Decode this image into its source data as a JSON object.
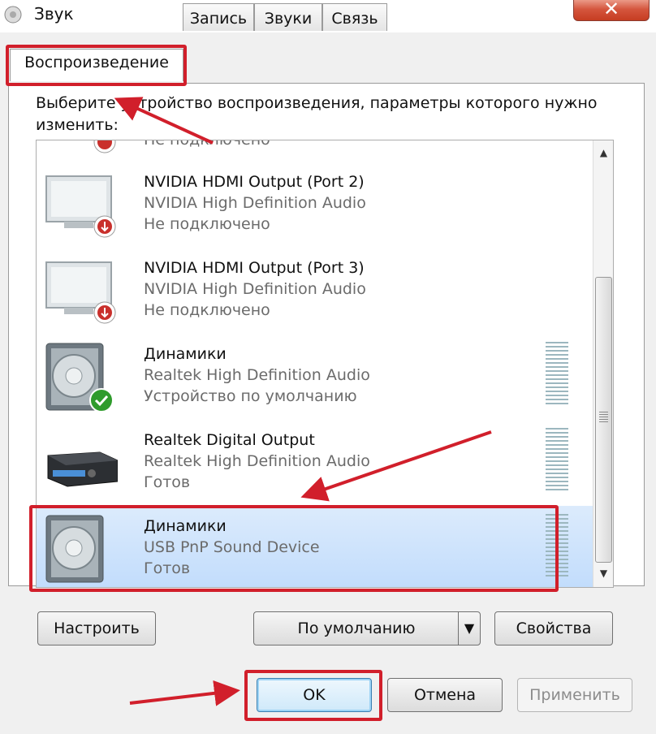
{
  "window": {
    "title": "Звук"
  },
  "tabs": [
    {
      "label": "Воспроизведение",
      "active": true
    },
    {
      "label": "Запись",
      "active": false
    },
    {
      "label": "Звуки",
      "active": false
    },
    {
      "label": "Связь",
      "active": false
    }
  ],
  "instruction": "Выберите устройство воспроизведения, параметры которого нужно изменить:",
  "partial_item_text": "Не подключено",
  "devices": [
    {
      "name": "NVIDIA HDMI Output (Port 2)",
      "driver": "NVIDIA High Definition Audio",
      "status": "Не подключено",
      "icon": "monitor-icon",
      "badge": "disconnected-badge-icon"
    },
    {
      "name": "NVIDIA HDMI Output (Port 3)",
      "driver": "NVIDIA High Definition Audio",
      "status": "Не подключено",
      "icon": "monitor-icon",
      "badge": "disconnected-badge-icon"
    },
    {
      "name": "Динамики",
      "driver": "Realtek High Definition Audio",
      "status": "Устройство по умолчанию",
      "icon": "speaker-icon",
      "badge": "default-check-icon"
    },
    {
      "name": "Realtek Digital Output",
      "driver": "Realtek High Definition Audio",
      "status": "Готов",
      "icon": "receiver-icon"
    },
    {
      "name": "Динамики",
      "driver": "USB PnP Sound Device",
      "status": "Готов",
      "icon": "speaker-icon",
      "selected": true
    }
  ],
  "buttons": {
    "configure": "Настроить",
    "set_default": "По умолчанию",
    "properties": "Свойства",
    "ok": "OK",
    "cancel": "Отмена",
    "apply": "Применить"
  },
  "colors": {
    "annotation": "#d11f2b",
    "selection": "#c1dcfc"
  }
}
